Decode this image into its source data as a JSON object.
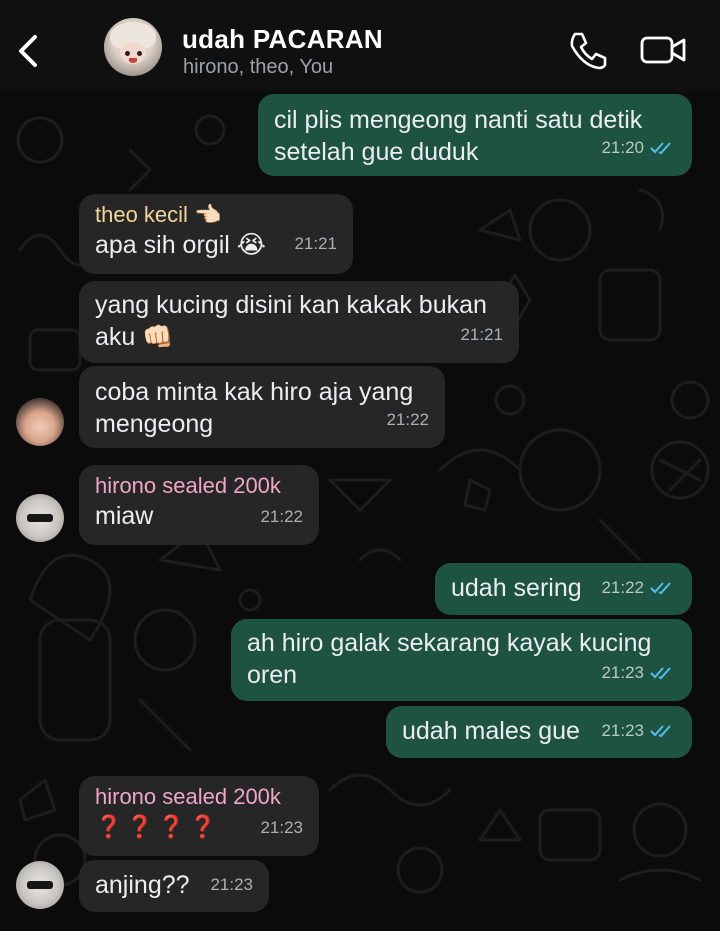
{
  "header": {
    "title": "udah PACARAN",
    "members": "hirono, theo, You",
    "icons": [
      "chevron-left-icon",
      "phone-icon",
      "video-camera-icon"
    ]
  },
  "colors": {
    "incoming_bubble": "#262626",
    "outgoing_bubble": "#1f5341",
    "read_ticks": "#53bdeb",
    "theo_name": "#f3d49b",
    "hirono_name": "#f0a6c8"
  },
  "messages": [
    {
      "direction": "out",
      "text_lines": [
        "cil plis mengeong nanti satu detik",
        "setelah gue duduk"
      ],
      "time": "21:20",
      "read": true
    },
    {
      "direction": "in",
      "sender": "theo kecil 👈🏻",
      "text_lines": [
        "apa sih orgil 😭"
      ],
      "time": "21:21"
    },
    {
      "direction": "in",
      "text_lines": [
        "yang kucing disini kan kakak bukan",
        "aku 👊🏻"
      ],
      "time": "21:21"
    },
    {
      "direction": "in",
      "text_lines": [
        "coba minta kak hiro aja yang",
        "mengeong"
      ],
      "time": "21:22"
    },
    {
      "direction": "in",
      "sender": "hirono sealed 200k",
      "text_lines": [
        "miaw"
      ],
      "time": "21:22"
    },
    {
      "direction": "out",
      "text_lines": [
        "udah sering"
      ],
      "time": "21:22",
      "read": true
    },
    {
      "direction": "out",
      "text_lines": [
        "ah hiro galak sekarang kayak kucing",
        "oren"
      ],
      "time": "21:23",
      "read": true
    },
    {
      "direction": "out",
      "text_lines": [
        "udah males gue"
      ],
      "time": "21:23",
      "read": true
    },
    {
      "direction": "in",
      "sender": "hirono sealed 200k",
      "text_lines": [
        "❓❓❓❓"
      ],
      "time": "21:23"
    },
    {
      "direction": "in",
      "text_lines": [
        "anjing??"
      ],
      "time": "21:23"
    }
  ]
}
